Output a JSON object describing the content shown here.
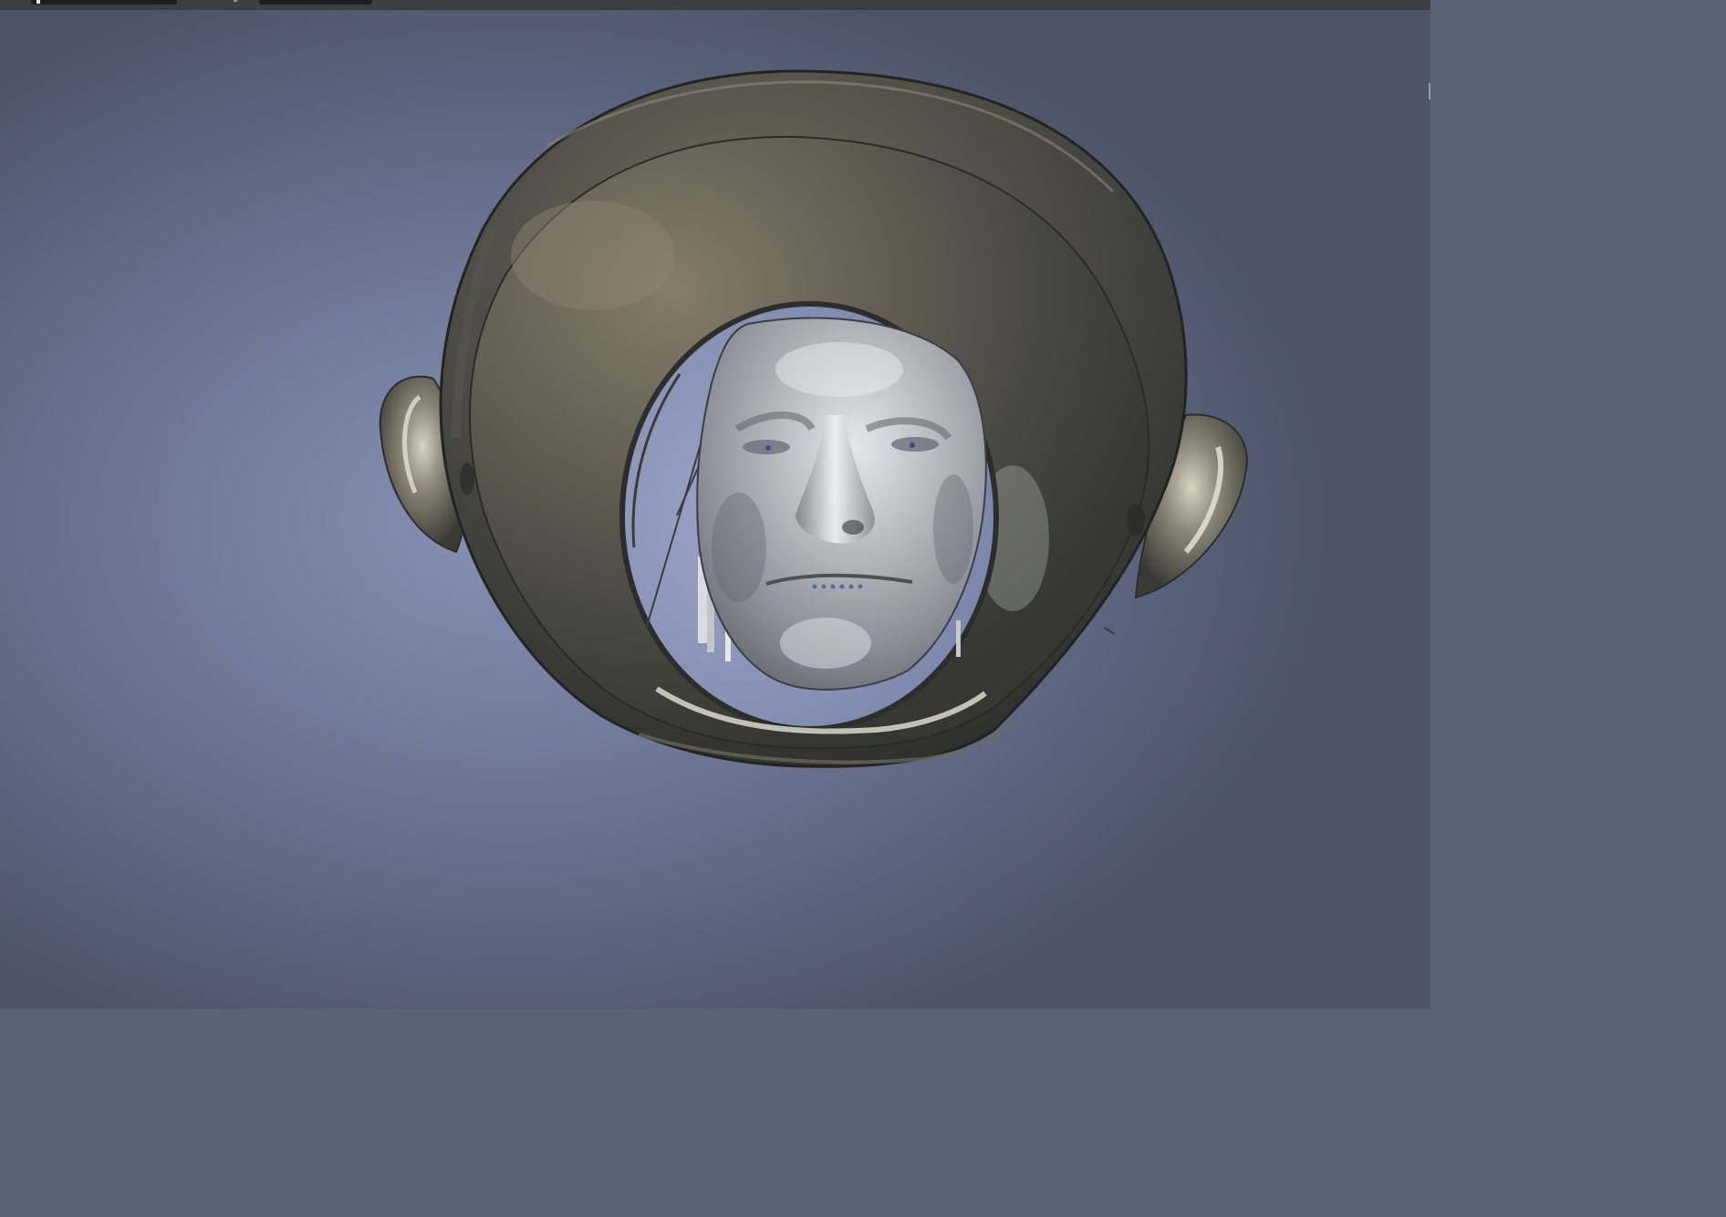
{
  "window": {
    "toolbar": {
      "field_1": "",
      "field_2": ""
    }
  },
  "viewport": {
    "background_color": "#727c9c",
    "model": {
      "parts": [
        "head-shell",
        "face",
        "ear-left",
        "ear-right",
        "electrode-wires"
      ],
      "material_color": "#5a574c",
      "face_color": "#b8bcc4"
    }
  }
}
